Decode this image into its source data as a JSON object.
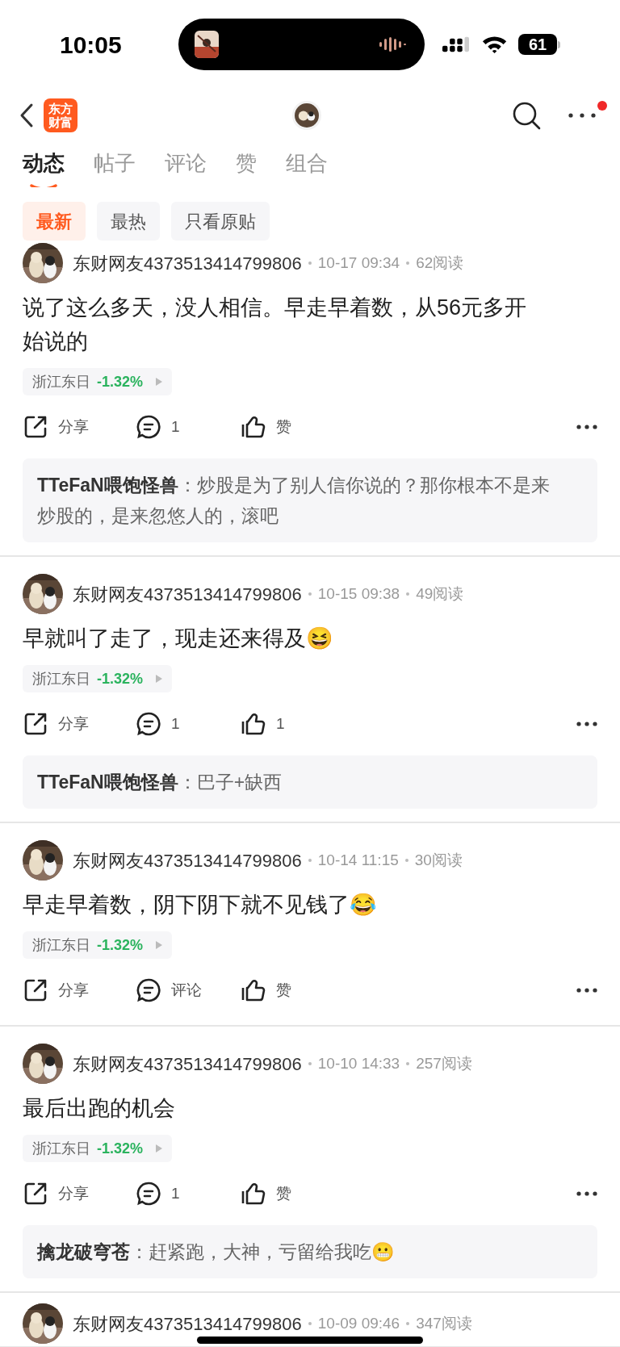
{
  "status_bar": {
    "time": "10:05",
    "battery": "61"
  },
  "header": {
    "logo_lines": [
      "东方",
      "财富"
    ],
    "notification_dot": true
  },
  "tabs": [
    {
      "label": "动态",
      "selected": true
    },
    {
      "label": "帖子",
      "selected": false
    },
    {
      "label": "评论",
      "selected": false
    },
    {
      "label": "赞",
      "selected": false
    },
    {
      "label": "组合",
      "selected": false
    }
  ],
  "filters": [
    {
      "label": "最新",
      "selected": true
    },
    {
      "label": "最热",
      "selected": false
    },
    {
      "label": "只看原贴",
      "selected": false
    }
  ],
  "posts": [
    {
      "author": "东财网友4373513414799806",
      "date": "10-17 09:34",
      "reads": "62阅读",
      "text": "说了这么多天，没人相信。早走早着数，从56元多开始说的",
      "stock": {
        "name": "浙江东日",
        "change": "-1.32%"
      },
      "share": "分享",
      "comments": "1",
      "likes": "赞",
      "reply": {
        "author": "TTeFaN喂饱怪兽",
        "separator": "：",
        "text": "炒股是为了别人信你说的？那你根本不是来炒股的，是来忽悠人的，滚吧"
      }
    },
    {
      "author": "东财网友4373513414799806",
      "date": "10-15 09:38",
      "reads": "49阅读",
      "text": "早就叫了走了，现走还来得及😆",
      "stock": {
        "name": "浙江东日",
        "change": "-1.32%"
      },
      "share": "分享",
      "comments": "1",
      "likes": "1",
      "reply": {
        "author": "TTeFaN喂饱怪兽",
        "separator": "：",
        "text": "巴子+缺西"
      }
    },
    {
      "author": "东财网友4373513414799806",
      "date": "10-14 11:15",
      "reads": "30阅读",
      "text": "早走早着数，阴下阴下就不见钱了😂",
      "stock": {
        "name": "浙江东日",
        "change": "-1.32%"
      },
      "share": "分享",
      "comments": "评论",
      "likes": "赞"
    },
    {
      "author": "东财网友4373513414799806",
      "date": "10-10 14:33",
      "reads": "257阅读",
      "text": "最后出跑的机会",
      "stock": {
        "name": "浙江东日",
        "change": "-1.32%"
      },
      "share": "分享",
      "comments": "1",
      "likes": "赞",
      "reply": {
        "author": "擒龙破穹苍",
        "separator": "：",
        "text": "赶紧跑，大神，亏留给我吃😬"
      }
    },
    {
      "author": "东财网友4373513414799806",
      "date": "10-09 09:46",
      "reads": "347阅读"
    }
  ]
}
